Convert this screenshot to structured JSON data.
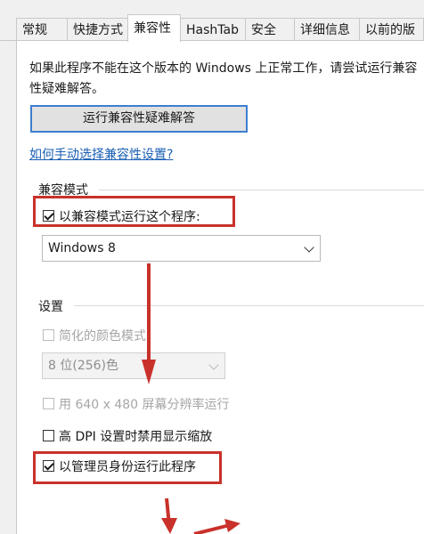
{
  "tabs": [
    {
      "label": "常规",
      "active": false
    },
    {
      "label": "快捷方式",
      "active": false
    },
    {
      "label": "兼容性",
      "active": true
    },
    {
      "label": "HashTab",
      "active": false
    },
    {
      "label": "安全",
      "active": false
    },
    {
      "label": "详细信息",
      "active": false
    },
    {
      "label": "以前的版",
      "active": false
    }
  ],
  "description": "如果此程序不能在这个版本的 Windows 上正常工作，请尝试运行兼容性疑难解答。",
  "troubleshoot_button": "运行兼容性疑难解答",
  "manual_link": "如何手动选择兼容性设置?",
  "compat_mode": {
    "group_label": "兼容模式",
    "checkbox_label": "以兼容模式运行这个程序:",
    "checked": true,
    "selected_os": "Windows 8"
  },
  "settings": {
    "group_label": "设置",
    "reduced_color_label": "简化的颜色模式",
    "color_select_value": "8 位(256)色",
    "res640_label": "用 640 x 480 屏幕分辨率运行",
    "dpi_label": "高 DPI 设置时禁用显示缩放",
    "admin_label": "以管理员身份运行此程序",
    "admin_checked": true
  },
  "colors": {
    "annotation_red": "#c9312b",
    "link_blue": "#1a5fb4",
    "button_focus": "#3b7fd1"
  }
}
